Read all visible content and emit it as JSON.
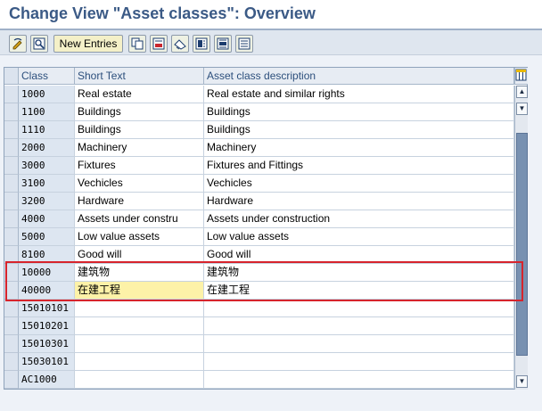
{
  "window": {
    "title": "Change View \"Asset classes\": Overview"
  },
  "toolbar": {
    "new_entries_label": "New Entries",
    "icons": [
      "display-change-icon",
      "find-icon",
      "copy-icon",
      "delete-icon",
      "undo-icon",
      "select-all-icon",
      "select-block-icon",
      "deselect-all-icon"
    ]
  },
  "table": {
    "columns": [
      "Class",
      "Short Text",
      "Asset class description"
    ],
    "rows": [
      {
        "class": "1000",
        "short_text": "Real estate",
        "description": "Real estate and similar rights"
      },
      {
        "class": "1100",
        "short_text": "Buildings",
        "description": "Buildings"
      },
      {
        "class": "1110",
        "short_text": "Buildings",
        "description": "Buildings"
      },
      {
        "class": "2000",
        "short_text": "Machinery",
        "description": "Machinery"
      },
      {
        "class": "3000",
        "short_text": "Fixtures",
        "description": "Fixtures and Fittings"
      },
      {
        "class": "3100",
        "short_text": "Vechicles",
        "description": "Vechicles"
      },
      {
        "class": "3200",
        "short_text": "Hardware",
        "description": "Hardware"
      },
      {
        "class": "4000",
        "short_text": "Assets under constru",
        "description": "Assets under construction"
      },
      {
        "class": "5000",
        "short_text": "Low value assets",
        "description": "Low value assets"
      },
      {
        "class": "8100",
        "short_text": "Good will",
        "description": "Good will"
      },
      {
        "class": "10000",
        "short_text": "建筑物",
        "description": "建筑物"
      },
      {
        "class": "40000",
        "short_text": "在建工程",
        "description": "在建工程"
      },
      {
        "class": "15010101",
        "short_text": "",
        "description": ""
      },
      {
        "class": "15010201",
        "short_text": "",
        "description": ""
      },
      {
        "class": "15010301",
        "short_text": "",
        "description": ""
      },
      {
        "class": "15030101",
        "short_text": "",
        "description": ""
      },
      {
        "class": "AC1000",
        "short_text": "",
        "description": ""
      }
    ]
  },
  "colors": {
    "title": "#3b5a86",
    "highlight": "#d7242c",
    "focus_cell": "#fdf2a8"
  }
}
